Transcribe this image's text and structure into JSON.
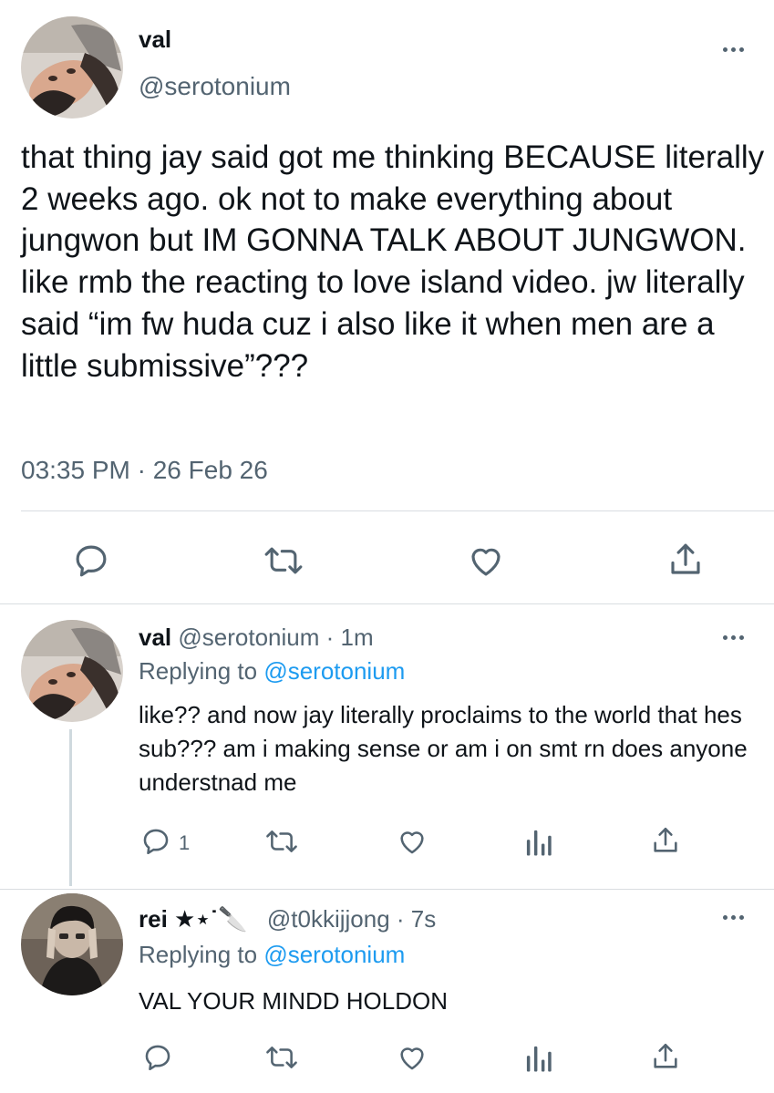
{
  "main_tweet": {
    "display_name": "val",
    "handle": "@serotonium",
    "text": "that thing jay said got me thinking BECAUSE literally 2 weeks ago. ok not to make everything about jungwon but IM GONNA TALK ABOUT JUNGWON. like rmb the reacting to love island video. jw literally said “im fw huda cuz i also like it when men are a little submissive”???",
    "timestamp": "03:35 PM · 26 Feb 26",
    "actions": [
      "reply-icon",
      "retweet-icon",
      "like-icon",
      "share-icon"
    ]
  },
  "replies": [
    {
      "display_name": "val",
      "handle_time": "@serotonium · 1m",
      "replying_prefix": "Replying to ",
      "replying_to": "@serotonium",
      "text": "like?? and now jay literally proclaims to the world that hes sub??? am i making sense or am i on smt rn does anyone understnad me",
      "reply_count": "1",
      "actions": [
        "reply-icon",
        "retweet-icon",
        "like-icon",
        "analytics-icon",
        "share-icon"
      ]
    },
    {
      "display_name": "rei ★⋆˙🔪",
      "handle_time": "@t0kkijjong · 7s",
      "replying_prefix": "Replying to ",
      "replying_to": "@serotonium",
      "text": "VAL YOUR MINDD HOLDON",
      "reply_count": "",
      "actions": [
        "reply-icon",
        "retweet-icon",
        "like-icon",
        "analytics-icon",
        "share-icon"
      ]
    }
  ],
  "colors": {
    "text": "#0f1419",
    "secondary": "#536471",
    "link": "#1d9bf0",
    "divider": "#d9dde1"
  }
}
